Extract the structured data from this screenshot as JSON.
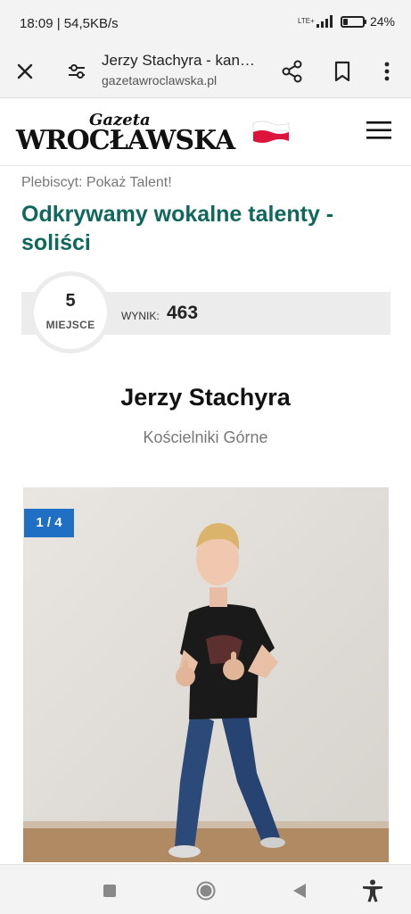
{
  "status_bar": {
    "time_speed": "18:09 | 54,5KB/s",
    "network": "LTE+",
    "battery_percent": "24",
    "battery_level": 0.24
  },
  "browser": {
    "page_title": "Jerzy Stachyra - kan…",
    "url": "gazetawroclawska.pl",
    "icons": [
      "close-icon",
      "page-settings-icon",
      "share-icon",
      "bookmark-icon",
      "more-vert-icon"
    ]
  },
  "site": {
    "logo_small": "Gazeta",
    "logo_main": "WROCŁAWSKA",
    "flag_colors": [
      "#ffffff",
      "#dc143c"
    ],
    "menu_icon": "hamburger-menu-icon"
  },
  "article": {
    "breadcrumb": "Plebiscyt: Pokaż Talent!",
    "headline": "Odkrywamy wokalne talenty - soliści",
    "accent_color": "#10675c"
  },
  "score": {
    "rank": "5",
    "rank_label": "MIEJSCE",
    "label": "WYNIK:",
    "value": "463"
  },
  "person": {
    "name": "Jerzy Stachyra",
    "location": "Kościelniki Górne"
  },
  "gallery": {
    "counter": "1 / 4",
    "badge_color": "#1f6fc5"
  },
  "navigation_bar": {
    "icons": [
      "recent-apps-icon",
      "home-icon",
      "back-icon",
      "accessibility-icon"
    ]
  }
}
